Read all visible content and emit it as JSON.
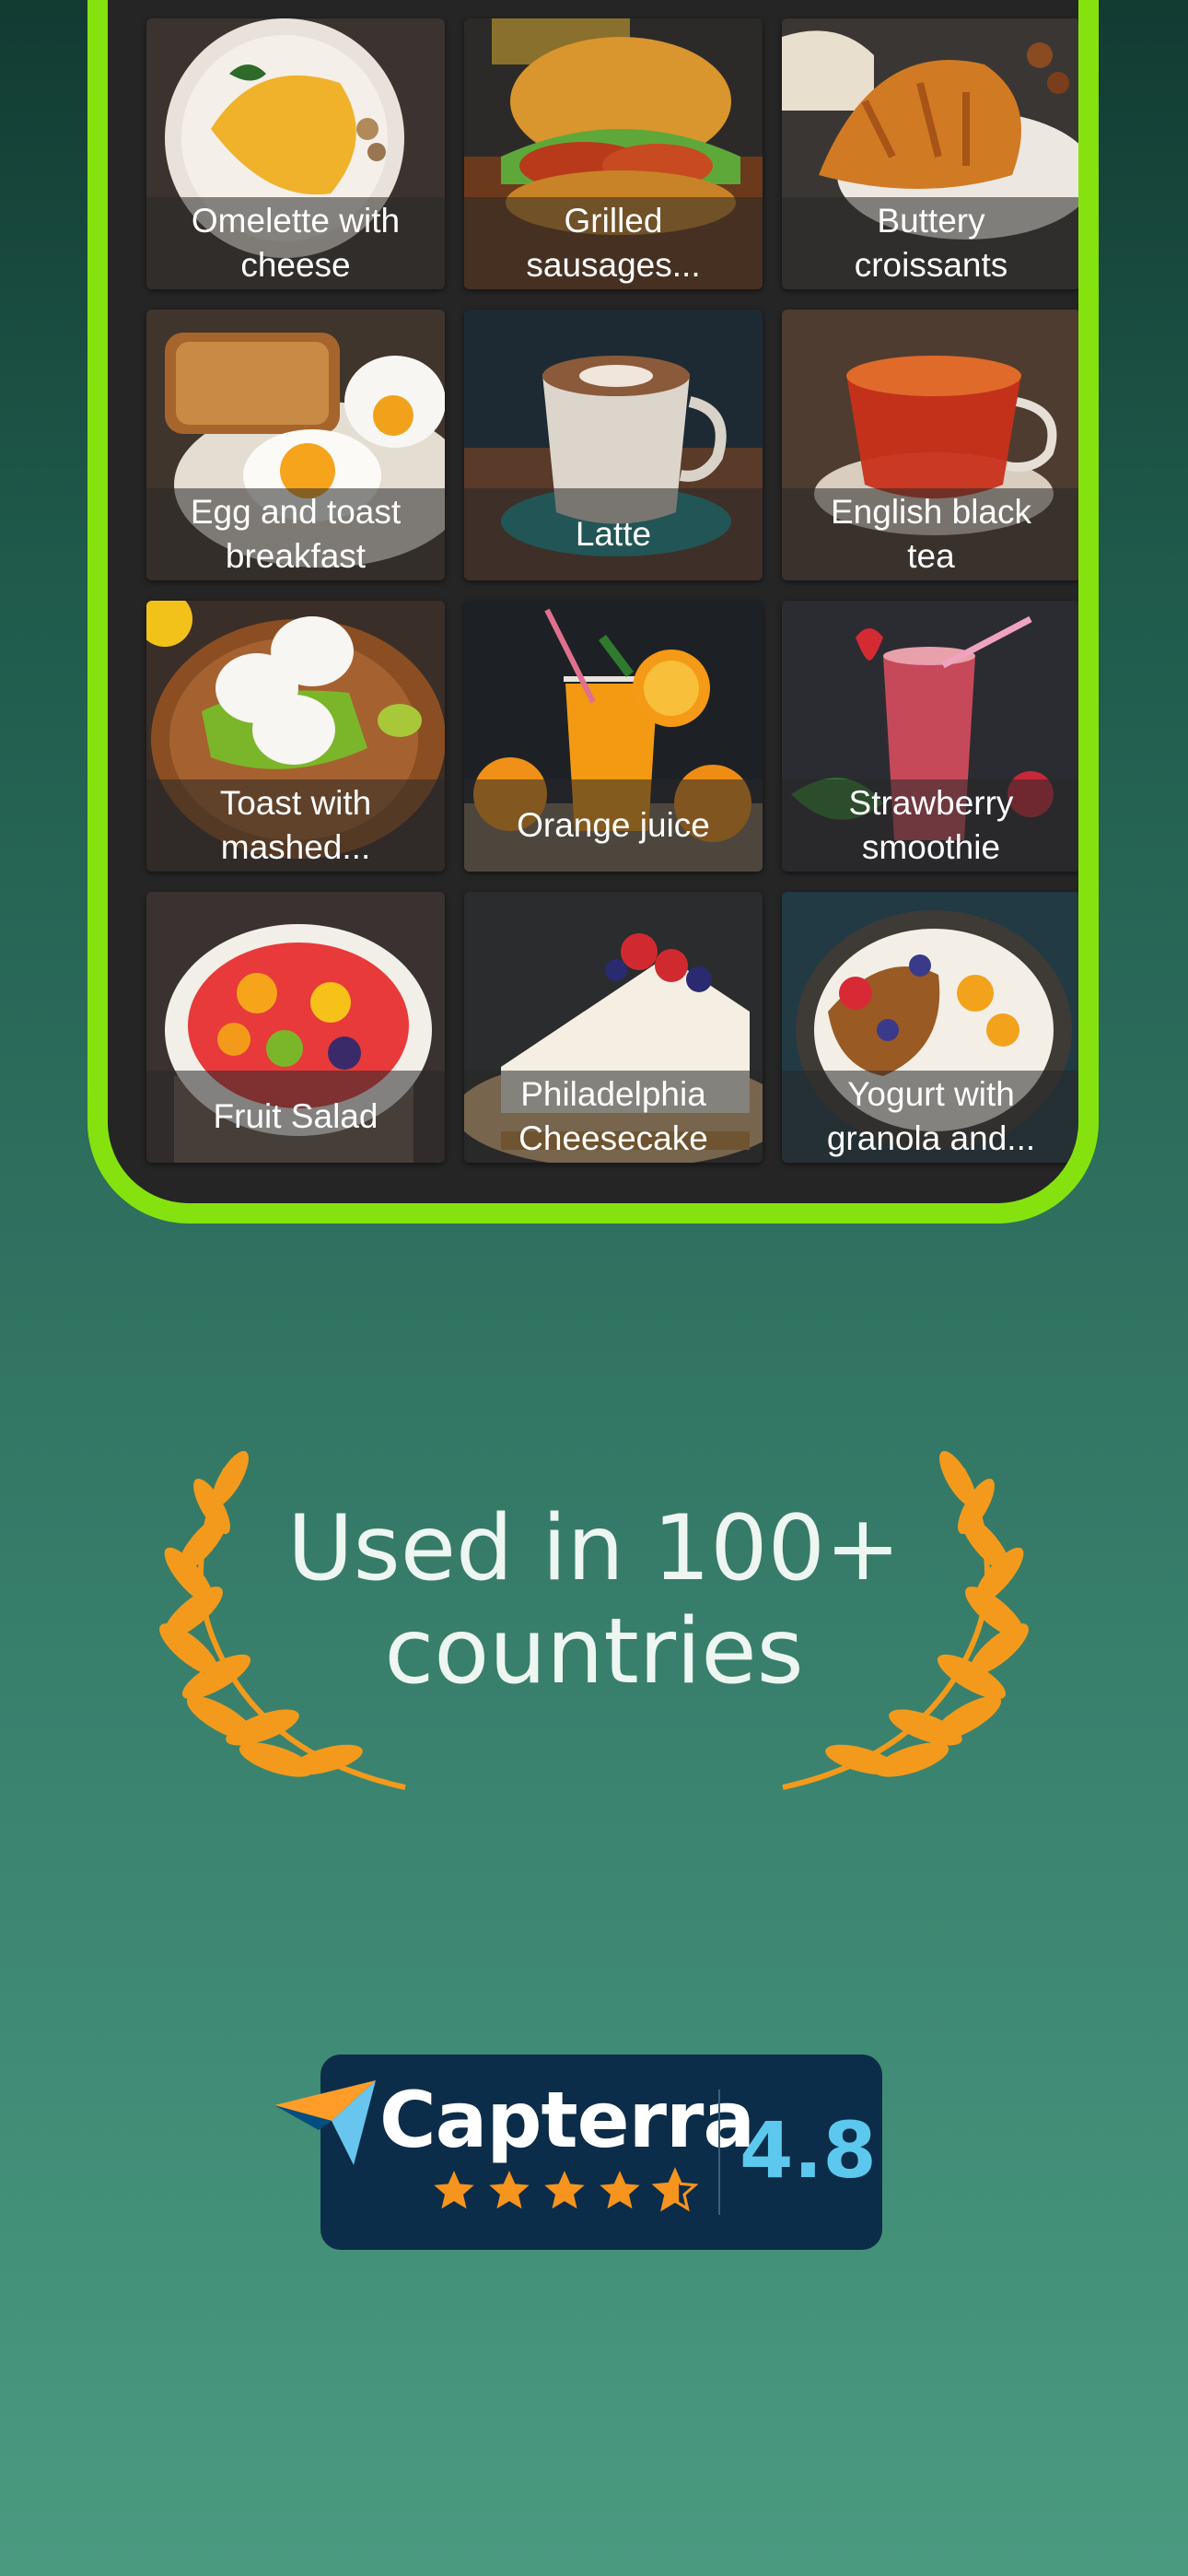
{
  "grid": {
    "items": [
      {
        "title": "Omelette with cheese",
        "line1": "Omelette with",
        "line2": "cheese"
      },
      {
        "title": "Grilled sausages...",
        "line1": "Grilled",
        "line2": "sausages..."
      },
      {
        "title": "Buttery croissants",
        "line1": "Buttery",
        "line2": "croissants"
      },
      {
        "title": "Egg and toast breakfast",
        "line1": "Egg and toast",
        "line2": "breakfast"
      },
      {
        "title": "Latte",
        "line1": "Latte",
        "line2": ""
      },
      {
        "title": "English black tea",
        "line1": "English black",
        "line2": "tea"
      },
      {
        "title": "Toast with mashed...",
        "line1": "Toast with",
        "line2": "mashed..."
      },
      {
        "title": "Orange juice",
        "line1": "Orange juice",
        "line2": ""
      },
      {
        "title": "Strawberry smoothie",
        "line1": "Strawberry",
        "line2": "smoothie"
      },
      {
        "title": "Fruit Salad",
        "line1": "Fruit Salad",
        "line2": ""
      },
      {
        "title": "Philadelphia Cheesecake",
        "line1": "Philadelphia",
        "line2": "Cheesecake"
      },
      {
        "title": "Yogurt with granola and...",
        "line1": "Yogurt with",
        "line2": "granola and..."
      }
    ]
  },
  "headline": {
    "line1": "Used in 100+",
    "line2": "countries"
  },
  "badge": {
    "brand": "Capterra",
    "rating": "4.8",
    "stars_filled": 4.5,
    "stars_total": 5
  },
  "colors": {
    "frame": "#86e20f",
    "laurel": "#f39a1c",
    "badge_bg": "#0c2d49",
    "rating": "#5cc8ee",
    "star": "#f7941d"
  },
  "icons": [
    "laurel-left-icon",
    "laurel-right-icon",
    "capterra-flag-icon",
    "star-icon"
  ]
}
